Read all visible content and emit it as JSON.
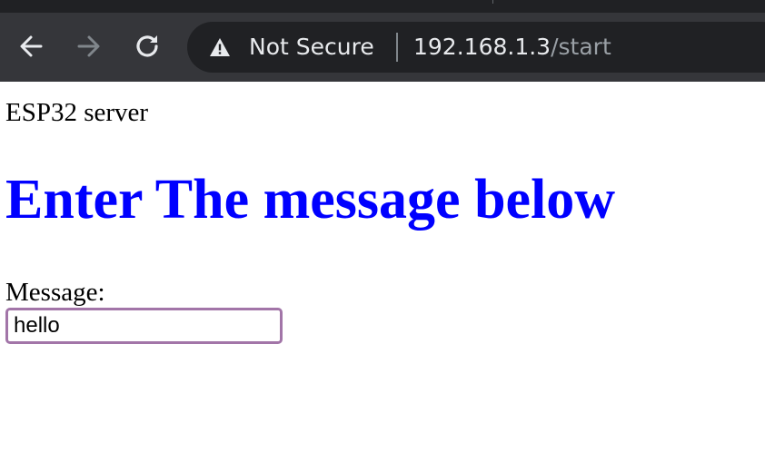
{
  "browser": {
    "security_label": "Not Secure",
    "url_host": "192.168.1.3",
    "url_path": "/start",
    "icons": {
      "back": "arrow-left-icon",
      "forward": "arrow-right-icon",
      "reload": "reload-icon",
      "security": "warning-triangle-icon"
    },
    "colors": {
      "toolbar": "#35363a",
      "omnibox": "#202124",
      "forward_disabled": "#80868b"
    }
  },
  "page": {
    "server_text": "ESP32 server",
    "heading": "Enter The message below",
    "heading_color": "#0000ff",
    "form": {
      "message_label": "Message:",
      "message_value": "hello",
      "input_border_color": "#a275a8"
    }
  }
}
